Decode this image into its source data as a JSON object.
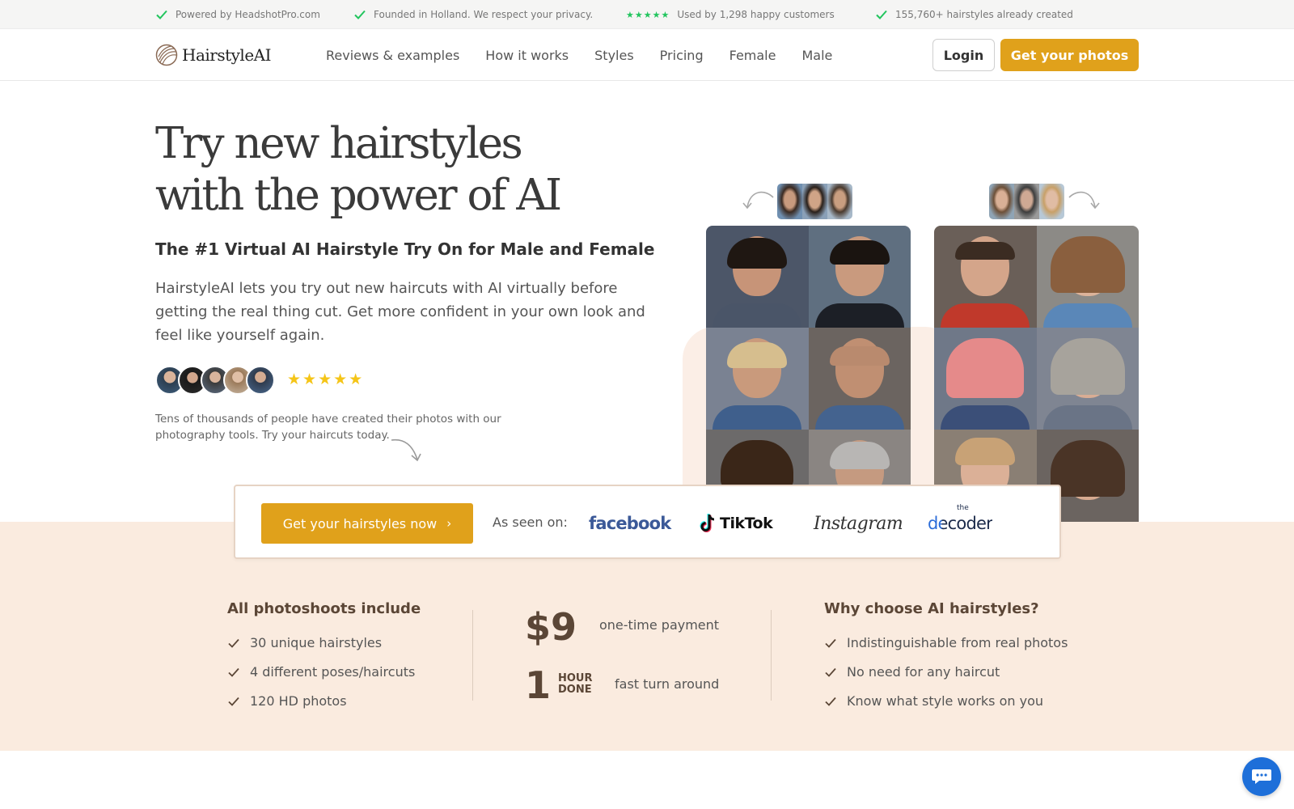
{
  "topbar": {
    "items": [
      {
        "text": "Powered by HeadshotPro.com",
        "icon": "check-icon"
      },
      {
        "text": "Founded in Holland. We respect your privacy.",
        "icon": "check-icon"
      },
      {
        "text": "Used by 1,298 happy customers",
        "icon": "stars-icon",
        "stars": "★★★★★"
      },
      {
        "text": "155,760+ hairstyles already created",
        "icon": "check-icon"
      }
    ]
  },
  "header": {
    "logo_text": "HairstyleAI",
    "nav": [
      "Reviews & examples",
      "How it works",
      "Styles",
      "Pricing",
      "Female",
      "Male"
    ],
    "login_label": "Login",
    "cta_label": "Get your photos"
  },
  "hero": {
    "title_line1": "Try new hairstyles",
    "title_line2": "with the power of AI",
    "subtitle": "The #1 Virtual AI Hairstyle Try On for Male and Female",
    "description": "HairstyleAI lets you try out new haircuts with AI virtually before getting the real thing cut. Get more confident in your own look and feel like yourself again.",
    "rating_stars": "★★★★★",
    "note": "Tens of thousands of people have created their photos with our photography tools. Try your haircuts today."
  },
  "seen_on": {
    "cta_label": "Get your hairstyles now",
    "cta_chevron": "›",
    "label": "As seen on:",
    "brands": [
      "facebook",
      "TikTok",
      "Instagram",
      "the",
      "decoder"
    ]
  },
  "features": {
    "left_title": "All photoshoots include",
    "left_items": [
      "30 unique hairstyles",
      "4 different poses/haircuts",
      "120 HD photos"
    ],
    "price": "$9",
    "price_note": "one-time payment",
    "turnaround_number": "1",
    "turnaround_unit_1": "HOUR",
    "turnaround_unit_2": "DONE",
    "turnaround_note": "fast turn around",
    "right_title": "Why choose AI hairstyles?",
    "right_items": [
      "Indistinguishable from real photos",
      "No need for any haircut",
      "Know what style works on you"
    ]
  },
  "colors": {
    "accent": "#e0a11b",
    "brown": "#5b4636",
    "peach_band": "#faebdf",
    "check_green": "#22c55e",
    "chat_blue": "#1e6fd9"
  }
}
